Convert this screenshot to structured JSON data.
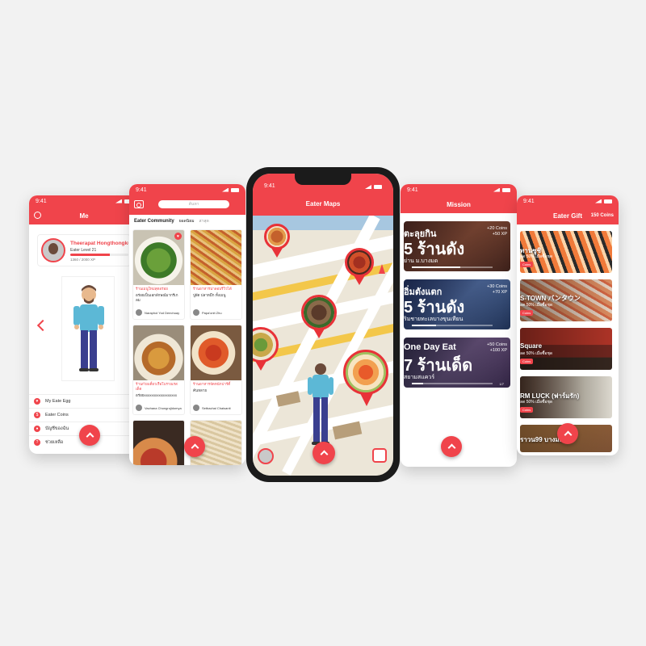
{
  "colors": {
    "brand": "#f0444b"
  },
  "me_screen": {
    "time": "9:41",
    "title": "Me",
    "profile_name": "Theerapat Hongthongku",
    "level": "Eater Level 21",
    "xp": "1360 / 2000 XP",
    "xp_fraction": 0.68,
    "menu": [
      {
        "icon": "egg-icon",
        "label": "My Eate Egg"
      },
      {
        "icon": "coin-icon",
        "label": "Eater Coins"
      },
      {
        "icon": "user-icon",
        "label": "บัญชีของฉัน"
      },
      {
        "icon": "help-icon",
        "label": "ช่วยเหลือ"
      }
    ]
  },
  "community_screen": {
    "time": "9:41",
    "search_placeholder": "ค้นหา",
    "heading": "Eater Community",
    "tab_popular": "ยอดนิยม",
    "tab_latest": "ล่าสุด",
    "posts": [
      {
        "title": "ร้านเมนูใหม่สุดอร่อย",
        "subtitle": "อร่อยเป็นเอกลักษณ์มากรีเกลม",
        "user": "Naraphol Yod Deechuay"
      },
      {
        "title": "ร้านอาหารน่าลอบรีวิวได้",
        "subtitle": "ปูผัด ปลาหมึก ทั้งเมนู",
        "user": "Papa'onit Zhu"
      },
      {
        "title": "ร้านก๋วยเตี๋ยวเรือโบราณรสเด็ด",
        "subtitle": "อร่อยxxxxxxxxxxxxxxxxxx",
        "user": "Vachana Chongrujidomya"
      },
      {
        "title": "ร้านอาหารจัดหนักปาร์ตี้",
        "subtitle": "ค้นหลาย",
        "user": "Setbachai Chaisanit"
      },
      {
        "title": "",
        "subtitle": "",
        "user": ""
      },
      {
        "title": "",
        "subtitle": "",
        "user": ""
      }
    ]
  },
  "map_screen": {
    "time": "9:41",
    "title": "Eater Maps"
  },
  "mission_screen": {
    "time": "9:41",
    "title": "Mission",
    "missions": [
      {
        "line1": "ตะลุยกิน",
        "line2": "5 ร้านดัง",
        "line3": "ย่าน ม.บางมด",
        "reward1": "+20 Coins",
        "reward2": "+50 XP",
        "progress": 0.6,
        "count": ""
      },
      {
        "line1": "อิ่มตังแตก",
        "line2": "5 ร้านดัง",
        "line3": "ริมชายทะเลบางขุนเทียน",
        "reward1": "+30 Coins",
        "reward2": "+70 XP",
        "progress": 0.3,
        "count": ""
      },
      {
        "line1": "One Day Eat",
        "line2": "7 ร้านเด็ด",
        "line3": "สยามสแควร์",
        "reward1": "+50 Coins",
        "reward2": "+100 XP",
        "progress": 0.14,
        "count": "1/7"
      }
    ]
  },
  "gift_screen": {
    "time": "9:41",
    "title": "Eater Gift",
    "coins": "150 Coins",
    "gifts": [
      {
        "name": "ทานซูชิ",
        "sub": "ลด 50% เมื่อซื้อชุด",
        "badge": "Coins"
      },
      {
        "name": "S-TOWN バンタウン",
        "sub": "ลด 50% เมื่อซื้อชุด",
        "badge": "Coins"
      },
      {
        "name": "Square",
        "sub": "ลด 50% เมื่อซื้อชุด",
        "badge": "Coins"
      },
      {
        "name": "RM LUCK (ฟาร์มรัก)",
        "sub": "ลด 50% เมื่อซื้อชุด",
        "badge": "Coins"
      },
      {
        "name": "ราวน99 บางมด",
        "sub": "",
        "badge": ""
      }
    ]
  }
}
